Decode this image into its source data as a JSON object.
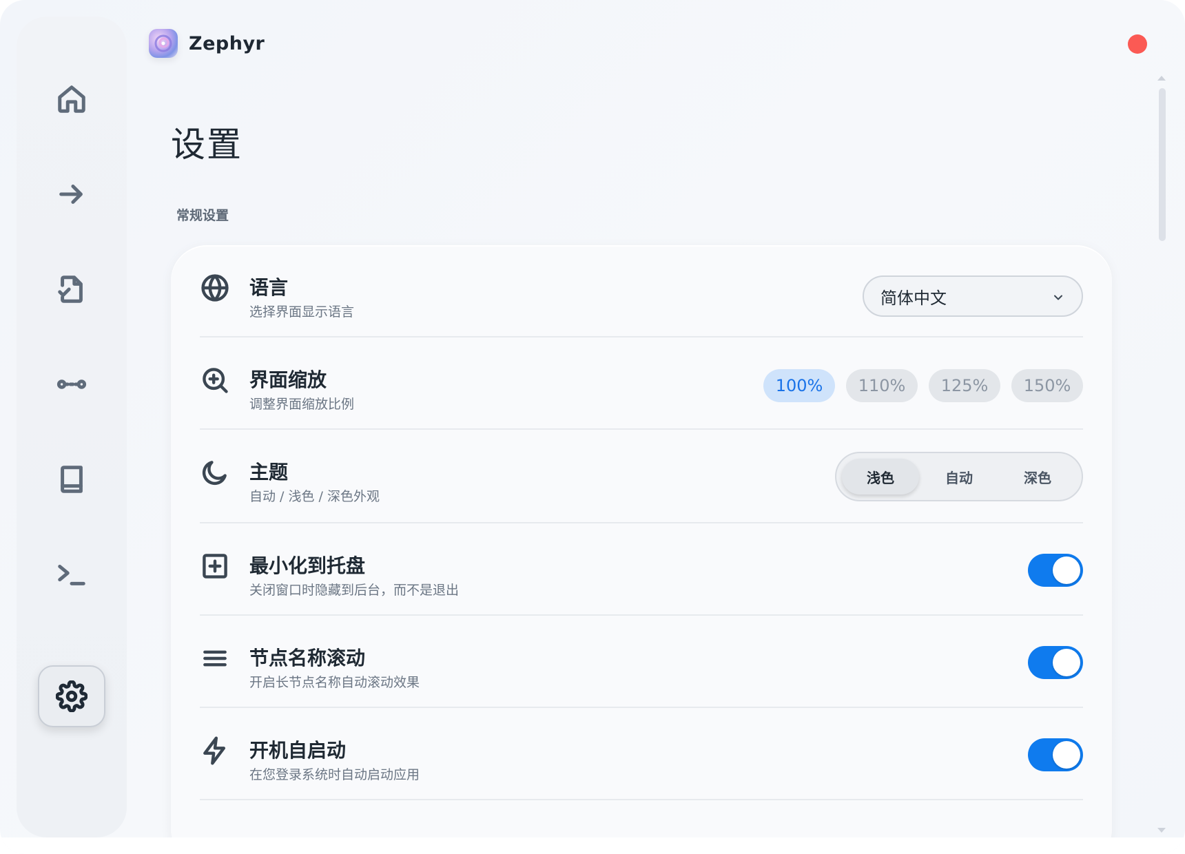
{
  "app": {
    "name": "Zephyr"
  },
  "icons": {
    "nav": [
      "home-icon",
      "arrow-right-icon",
      "file-check-icon",
      "connection-icon",
      "book-icon",
      "terminal-icon",
      "settings-icon"
    ],
    "rows": [
      "globe-icon",
      "zoom-in-icon",
      "moon-icon",
      "plus-square-icon",
      "menu-lines-icon",
      "lightning-icon"
    ]
  },
  "page": {
    "title": "设置",
    "section": "常规设置"
  },
  "settings": {
    "language": {
      "title": "语言",
      "desc": "选择界面显示语言",
      "value": "简体中文"
    },
    "zoom": {
      "title": "界面缩放",
      "desc": "调整界面缩放比例",
      "options": [
        "100%",
        "110%",
        "125%",
        "150%"
      ],
      "selected": "100%"
    },
    "theme": {
      "title": "主题",
      "desc": "自动 / 浅色 / 深色外观",
      "options": [
        "浅色",
        "自动",
        "深色"
      ],
      "selected": "浅色"
    },
    "tray": {
      "title": "最小化到托盘",
      "desc": "关闭窗口时隐藏到后台，而不是退出",
      "enabled": true
    },
    "scroll": {
      "title": "节点名称滚动",
      "desc": "开启长节点名称自动滚动效果",
      "enabled": true
    },
    "autostart": {
      "title": "开机自启动",
      "desc": "在您登录系统时自动启动应用",
      "enabled": true
    }
  },
  "colors": {
    "accent": "#0f7bee",
    "close": "#fb5a54",
    "zoom_active_bg": "#cfe3fb"
  }
}
